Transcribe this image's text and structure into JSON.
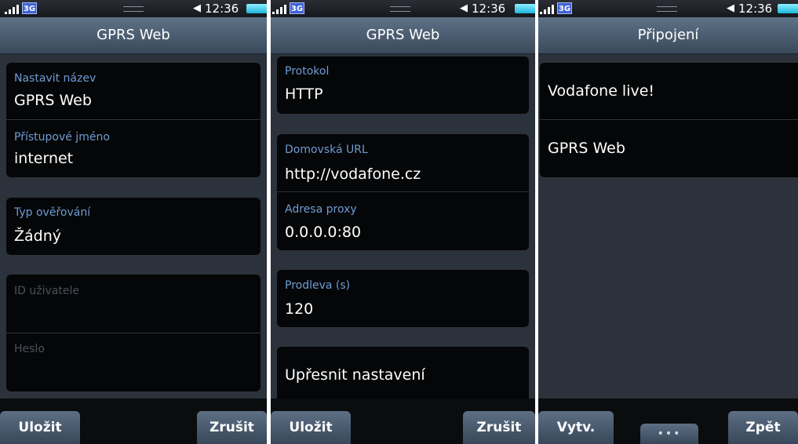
{
  "status": {
    "network": "3G",
    "time": "12:36"
  },
  "screens": [
    {
      "title": "GPRS Web",
      "fields": [
        {
          "label": "Nastavit název",
          "value": "GPRS Web"
        },
        {
          "label": "Přístupové jméno",
          "value": "internet"
        },
        {
          "label": "Typ ověřování",
          "value": "Žádný"
        },
        {
          "label": "ID uživatele",
          "value": ""
        },
        {
          "label": "Heslo",
          "value": ""
        }
      ],
      "buttons": {
        "left": "Uložit",
        "right": "Zrušit"
      }
    },
    {
      "title": "GPRS Web",
      "fields": [
        {
          "label": "Protokol",
          "value": "HTTP"
        },
        {
          "label": "Domovská URL",
          "value": "http://vodafone.cz"
        },
        {
          "label": "Adresa proxy",
          "value": "0.0.0.0:80"
        },
        {
          "label": "Prodleva (s)",
          "value": "120"
        }
      ],
      "advanced": "Upřesnit nastavení",
      "buttons": {
        "left": "Uložit",
        "right": "Zrušit"
      }
    },
    {
      "title": "Připojení",
      "items": [
        "Vodafone live!",
        "GPRS Web"
      ],
      "buttons": {
        "left": "Vytv.",
        "more": "•••",
        "right": "Zpět"
      }
    }
  ],
  "colors": {
    "label": "#6f9cd6",
    "background": "#2c323b",
    "card": "#050607",
    "button": "#4a5b70"
  }
}
